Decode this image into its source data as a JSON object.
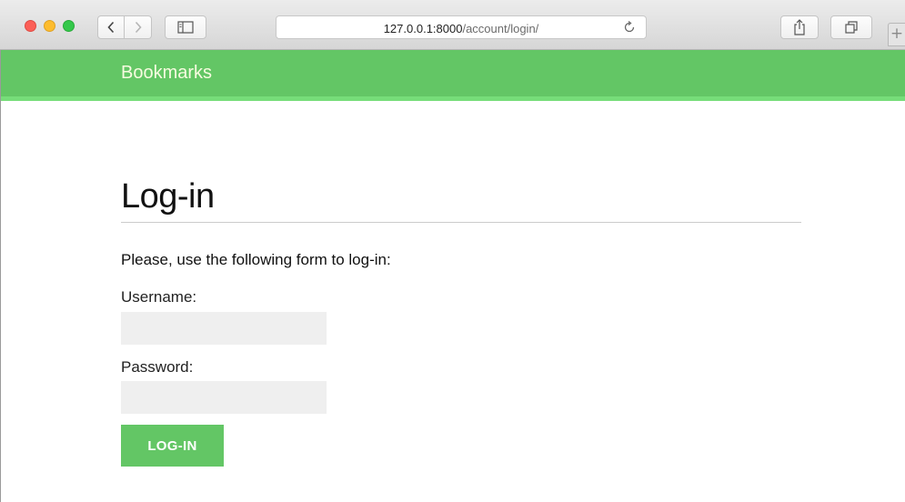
{
  "browser": {
    "url_host": "127.0.0.1:8000",
    "url_path": "/account/login/",
    "new_tab_symbol": "+"
  },
  "site": {
    "logo": "Bookmarks",
    "brand_color": "#63c665"
  },
  "page": {
    "title": "Log-in",
    "intro": "Please, use the following form to log-in:",
    "username_label": "Username:",
    "password_label": "Password:",
    "username_value": "",
    "password_value": "",
    "submit_label": "Log-in"
  }
}
